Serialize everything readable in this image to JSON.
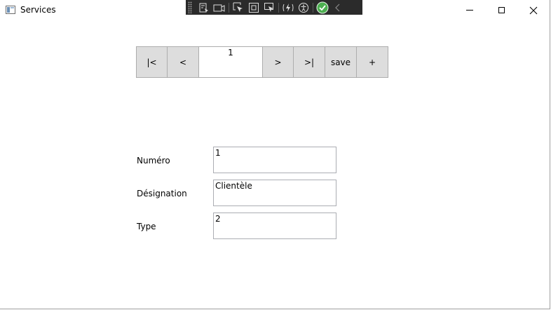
{
  "window": {
    "title": "Services"
  },
  "nav": {
    "first": "|<",
    "prev": "<",
    "page": "1",
    "next": ">",
    "last": ">|",
    "save": "save",
    "add": "+"
  },
  "form": {
    "numero": {
      "label": "Numéro",
      "value": "1"
    },
    "designation": {
      "label": "Désignation",
      "value": "Clientèle"
    },
    "type": {
      "label": "Type",
      "value": "2"
    }
  },
  "debug_toolbar": {
    "icons": [
      "live-visual-tree-icon",
      "record-icon",
      "select-element-icon",
      "display-layout-adorners-icon",
      "track-focus-icon",
      "hot-reload-icon",
      "accessibility-icon",
      "check-icon",
      "collapse-icon"
    ],
    "accent": "#4caf50"
  }
}
